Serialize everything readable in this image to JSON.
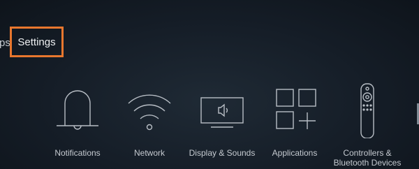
{
  "nav": {
    "partial_label": "ps",
    "selected_label": "Settings"
  },
  "tiles": [
    {
      "label": "Notifications",
      "icon": "bell-icon"
    },
    {
      "label": "Network",
      "icon": "wifi-icon"
    },
    {
      "label": "Display & Sounds",
      "icon": "display-icon"
    },
    {
      "label": "Applications",
      "icon": "apps-icon"
    },
    {
      "label": "Controllers &\nBluetooth Devices",
      "icon": "remote-icon"
    }
  ],
  "colors": {
    "focus_border": "#e8772e",
    "background": "#151d27",
    "icon_stroke": "#b8bec5"
  }
}
